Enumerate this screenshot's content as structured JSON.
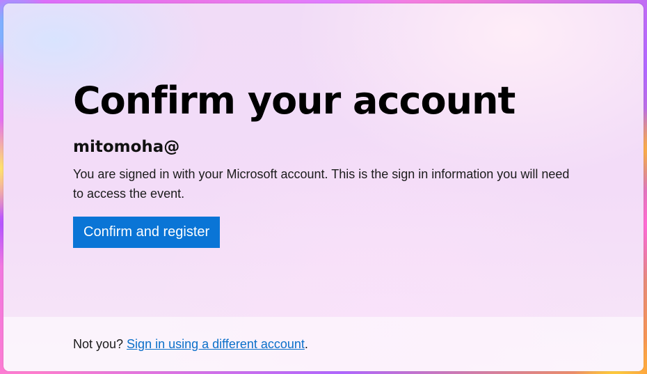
{
  "page": {
    "title": "Confirm your account",
    "account_email": "mitomoha@",
    "description": "You are signed in with your Microsoft account. This is the sign in information you will need to access the event.",
    "confirm_button_label": "Confirm and register"
  },
  "footer": {
    "prompt": "Not you? ",
    "link_label": "Sign in using a different account",
    "trailing": "."
  },
  "colors": {
    "accent": "#0a75d6",
    "link": "#0a6fc9"
  }
}
